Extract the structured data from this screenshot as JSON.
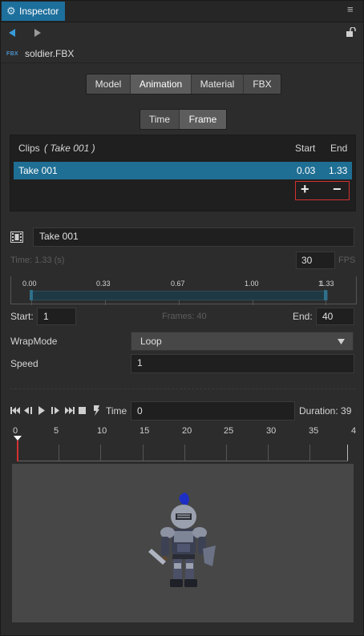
{
  "window": {
    "tab_label": "Inspector"
  },
  "asset": {
    "badge": "FBX",
    "name": "soldier.FBX"
  },
  "main_tabs": [
    "Model",
    "Animation",
    "Material",
    "FBX"
  ],
  "active_main_tab": "Animation",
  "mode_tabs": [
    "Time",
    "Frame"
  ],
  "active_mode_tab": "Frame",
  "clips": {
    "header": {
      "title": "Clips",
      "subtitle": "( Take 001 )",
      "start": "Start",
      "end": "End"
    },
    "rows": [
      {
        "name": "Take 001",
        "start": "0.03",
        "end": "1.33"
      }
    ],
    "add_label": "+",
    "remove_label": "−"
  },
  "clip_editor": {
    "name_value": "Take 001",
    "time_label": "Time: 1.33 (s)",
    "fps_value": "30",
    "fps_label": "FPS",
    "ruler_labels": [
      "0.00",
      "0.33",
      "0.67",
      "1.00",
      "1.33"
    ],
    "ruler_overlay": "1.",
    "start_label": "Start:",
    "start_value": "1",
    "frames_label": "Frames: 40",
    "end_label": "End:",
    "end_value": "40",
    "wrapmode_label": "WrapMode",
    "wrapmode_value": "Loop",
    "speed_label": "Speed",
    "speed_value": "1"
  },
  "playback": {
    "time_label": "Time",
    "time_value": "0",
    "duration_label": "Duration: 39",
    "ruler_labels": [
      "0",
      "5",
      "10",
      "15",
      "20",
      "25",
      "30",
      "35",
      "4"
    ]
  },
  "colors": {
    "accent": "#1f6e93",
    "highlight_box": "#d23131",
    "tab": "#1d6f9c"
  }
}
